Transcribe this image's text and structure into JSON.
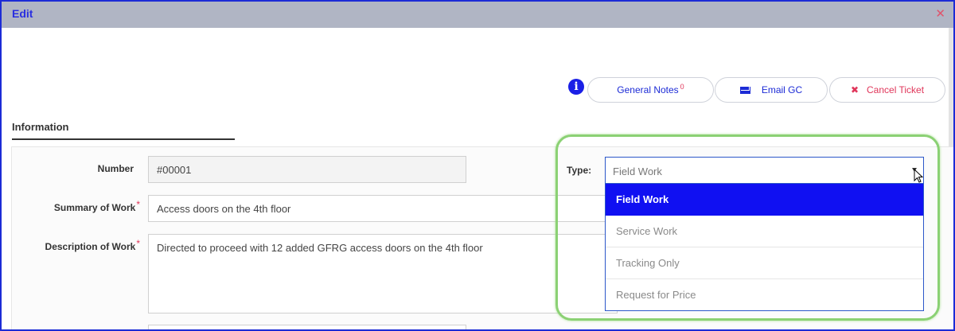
{
  "dialog": {
    "title": "Edit",
    "close_glyph": "✕"
  },
  "actions": {
    "info_glyph": "i",
    "general_notes_label": "General Notes",
    "general_notes_count": "0",
    "email_label": "Email GC",
    "cancel_glyph": "✖",
    "cancel_label": "Cancel Ticket"
  },
  "section": {
    "title": "Information"
  },
  "form": {
    "number_label": "Number",
    "number_value": "#00001",
    "summary_label": "Summary of Work",
    "summary_value": "Access doors on the 4th floor",
    "description_label": "Description of Work",
    "description_value": "Directed to proceed with 12 added GFRG access doors on the 4th floor",
    "required_mark": "*"
  },
  "type_select": {
    "label": "Type:",
    "value": "Field Work",
    "options": [
      "Field Work",
      "Service Work",
      "Tracking Only",
      "Request for Price"
    ],
    "selected_index": 0
  },
  "colors": {
    "accent": "#1c2bd6",
    "danger": "#e0365a",
    "highlight_ring": "#8bd174",
    "selected_option": "#1010f2"
  },
  "icons": [
    "info-icon",
    "envelope-icon",
    "x-icon",
    "close-icon",
    "dropdown-caret-icon",
    "mouse-cursor-icon"
  ]
}
